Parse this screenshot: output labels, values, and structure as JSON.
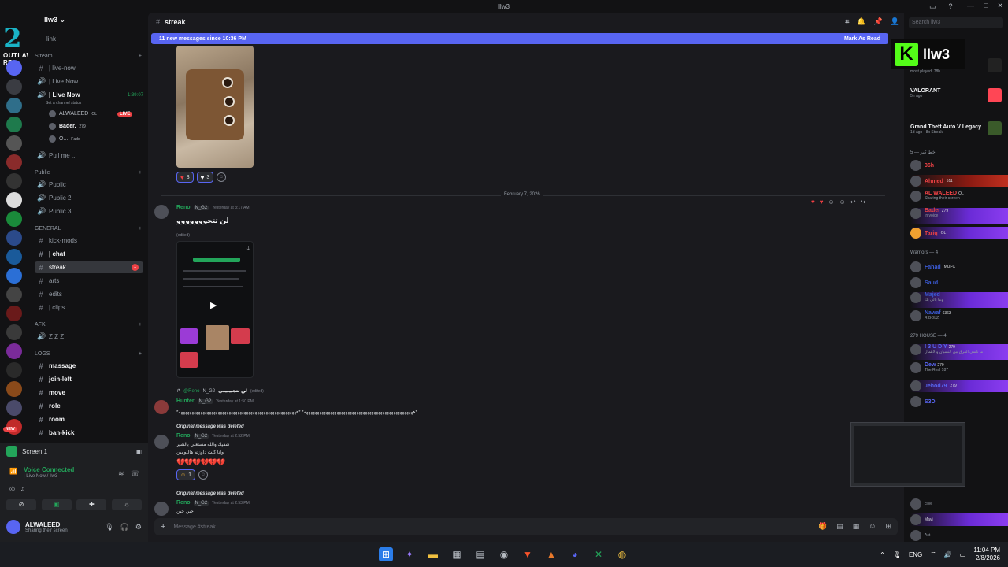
{
  "window": {
    "title": "llw3"
  },
  "server": {
    "name": "llw3",
    "logo_text": "OUTLAW RP"
  },
  "channels": {
    "top_item": "link",
    "stream_cat": "Stream",
    "live_now_1": "| live-now",
    "live_now_2": "| Live Now",
    "live_now_3": "| Live Now",
    "live_timer": "1:39:07",
    "set_status": "Set a channel status",
    "voice_user_1": "ALWALEED",
    "voice_user_1_tag": "OL",
    "live_badge": "LIVE",
    "voice_user_2": "Bader.",
    "voice_user_2_tag": "279",
    "voice_user_3": "O...",
    "voice_user_3_tag": "Fade",
    "pull_me": "Pull me ...",
    "public_cat": "Public",
    "public_1": "Public",
    "public_2": "Public 2",
    "public_3": "Public 3",
    "general_cat": "GENERAL",
    "kick_mods": "kick-mods",
    "chat": "| chat",
    "streak": "streak",
    "streak_badge": "1",
    "arts": "arts",
    "edits": "edits",
    "clips": "| clips",
    "afk_cat": "AFK",
    "afk_item": "Z Z Z",
    "logs_cat": "LOGS",
    "massage": "massage",
    "join_left": "join-left",
    "move": "move",
    "role": "role",
    "room": "room",
    "ban_kick": "ban-kick",
    "new_badge": "NEW"
  },
  "voice_panel": {
    "screen_label": "Screen 1",
    "connected": "Voice Connected",
    "connected_sub": "| Live Now / llw3",
    "user_name": "ALWALEED",
    "user_status": "Sharing their screen"
  },
  "chat": {
    "channel_name": "streak",
    "new_messages": "11 new messages since 10:36 PM",
    "mark_read": "Mark As Read",
    "reaction_1_count": "3",
    "reaction_2_count": "3",
    "date_divider": "February 7, 2026",
    "msg1_author": "Reno",
    "msg1_tag": "N_G2",
    "msg1_time": "Yesterday at 3:17 AM",
    "msg1_text": "لن تتجووووووو",
    "msg1_edited": "(edited)",
    "reply_author": "@Reno",
    "reply_tag": "N_G2",
    "reply_text": "لن تتجيييييي",
    "reply_edited": "(edited)",
    "msg2_author": "Hunter",
    "msg2_tag": "N_G2",
    "msg2_time": "Yesterday at 1:50 PM",
    "msg2_text": "*ههههههههههههههههههههههههههههههههههههههههههههههههههه* *ههههههههههههههههههههههههههههههههههههههههههههههههههههههه*",
    "deleted_1": "Original message was deleted",
    "msg3_author": "Reno",
    "msg3_tag": "N_G2",
    "msg3_time": "Yesterday at 2:52 PM",
    "msg3_line1": "شفيك والله مستغني بالشير",
    "msg3_line2": "وانا كنت داوزته هاليومين",
    "msg3_hearts": "💔💔💔💔💔💔",
    "msg3_react_count": "1",
    "deleted_2": "Original message was deleted",
    "msg4_author": "Reno",
    "msg4_tag": "N_G2",
    "msg4_time": "Yesterday at 2:53 PM",
    "msg4_text": "حين حين",
    "composer_placeholder": "Message #streak"
  },
  "members": {
    "search_placeholder": "Search llw3",
    "kick_name": "llw3",
    "activity_1_sub": "most played: 78h",
    "activity_2_title": "VALORANT",
    "activity_2_sub": "5h ago",
    "activity_3_title": "Grand Theft Auto V Legacy",
    "activity_3_sub": "1d ago · 8x Streak",
    "group_1": "خط كير — 5",
    "m1_name": "36h",
    "m2_name": "Ahmed",
    "m2_tag": "511",
    "m3_name": "AL WALEED",
    "m3_tag": "OL",
    "m3_sub": "Sharing their screen",
    "m4_name": "Bader",
    "m4_tag": "279",
    "m4_sub": "In voice",
    "m5_name": "Tariq",
    "m5_tag": "OL",
    "group_2": "Warriors — 4",
    "w1_name": "Fahad",
    "w1_tag": "MUFC",
    "w2_name": "Saud",
    "w3_name": "Majed",
    "w3_sub": "وما بالي بك",
    "w4_name": "Nawaf",
    "w4_tag": "6363",
    "w4_sub": "RIBOLZ",
    "group_3": "279 HOUSE — 4",
    "h1_name": "! 3 U D Y",
    "h1_tag": "279",
    "h1_sub": "ما ناسي الفرق بين النسيان والاهمال",
    "h2_name": "Dew",
    "h2_tag": "279",
    "h2_sub": "The Real 187",
    "h3_name": "Jehod79",
    "h3_tag": "279",
    "h4_name": "S3D",
    "b1_sub": "clive",
    "b2_tag": "Mavi",
    "b3_sub": "Act"
  },
  "taskbar": {
    "lang": "ENG",
    "time": "11:04 PM",
    "date": "2/8/2026"
  },
  "colors": {
    "accent": "#5865f2",
    "online": "#23a55a",
    "danger": "#ed4245",
    "kick": "#53fc18"
  }
}
